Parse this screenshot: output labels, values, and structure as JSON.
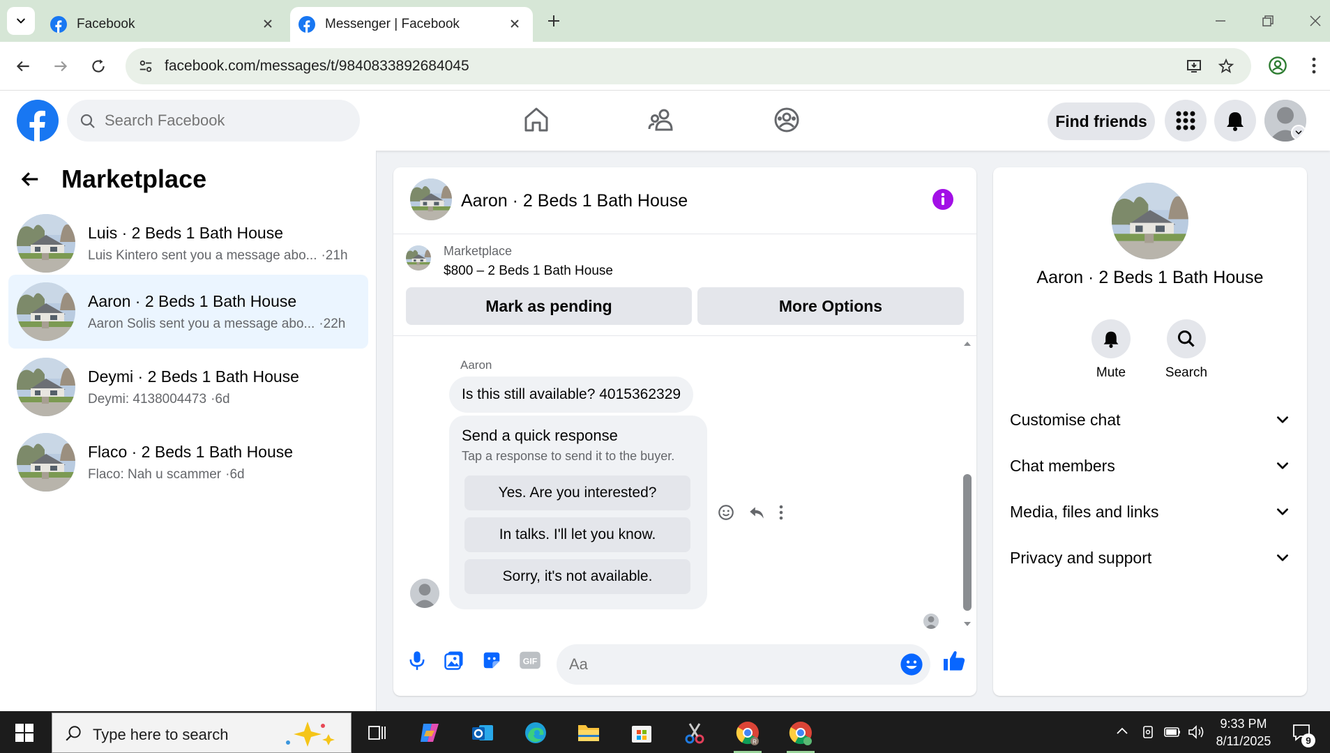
{
  "browser": {
    "tabs": [
      {
        "title": "Facebook",
        "active": false
      },
      {
        "title": "Messenger | Facebook",
        "active": true
      }
    ],
    "url": "facebook.com/messages/t/9840833892684045"
  },
  "facebook": {
    "search_placeholder": "Search Facebook",
    "find_friends": "Find friends",
    "accent_color": "#1877f2"
  },
  "marketplace": {
    "title": "Marketplace",
    "conversations": [
      {
        "name": "Luis · 2 Beds 1 Bath House",
        "preview": "Luis Kintero sent you a message abo...",
        "time": "·21h",
        "selected": false
      },
      {
        "name": "Aaron · 2 Beds 1 Bath House",
        "preview": "Aaron Solis sent you a message abo...",
        "time": "·22h",
        "selected": true
      },
      {
        "name": "Deymi · 2 Beds 1 Bath House",
        "preview": "Deymi: 4138004473",
        "time": "·6d",
        "selected": false
      },
      {
        "name": "Flaco · 2 Beds 1 Bath House",
        "preview": "Flaco: Nah u scammer",
        "time": "·6d",
        "selected": false
      }
    ]
  },
  "chat": {
    "title": "Aaron · 2 Beds 1 Bath House",
    "listing_source": "Marketplace",
    "listing_price": "$800 – 2 Beds 1 Bath House",
    "mark_pending": "Mark as pending",
    "more_options": "More Options",
    "sender": "Aaron",
    "message": "Is this still available? 4015362329",
    "quick_title": "Send a quick response",
    "quick_subtitle": "Tap a response to send it to the buyer.",
    "quick_replies": [
      "Yes. Are you interested?",
      "In talks. I'll let you know.",
      "Sorry, it's not available."
    ],
    "composer_placeholder": "Aa"
  },
  "details": {
    "title": "Aaron · 2 Beds 1 Bath House",
    "mute": "Mute",
    "search": "Search",
    "sections": [
      "Customise chat",
      "Chat members",
      "Media, files and links",
      "Privacy and support"
    ]
  },
  "taskbar": {
    "search_placeholder": "Type here to search",
    "time": "9:33 PM",
    "date": "8/11/2025",
    "notifications": "9"
  }
}
